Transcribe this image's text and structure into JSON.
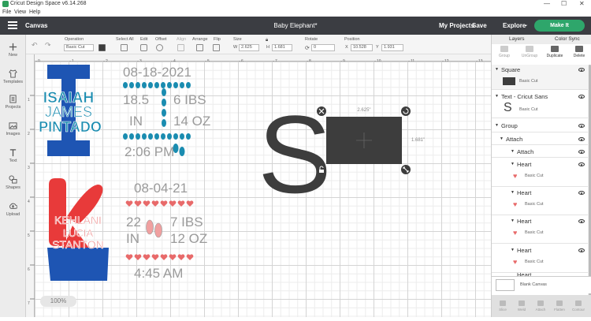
{
  "window": {
    "title": "Cricut Design Space  v6.14.268",
    "minimize": "—",
    "maximize": "☐",
    "close": "✕"
  },
  "menu": [
    "File",
    "View",
    "Help"
  ],
  "topbar": {
    "canvas_label": "Canvas",
    "project_title": "Baby Elephant*",
    "my_projects": "My Projects",
    "save": "Save",
    "explore": "Explore",
    "make_it": "Make It"
  },
  "toolbar": {
    "undo_icon": "undo-icon",
    "redo_icon": "redo-icon",
    "operation_label": "Operation",
    "operation_value": "Basic Cut",
    "select_all_label": "Select All",
    "edit_label": "Edit",
    "offset_label": "Offset",
    "align_label": "Align",
    "arrange_label": "Arrange",
    "flip_label": "Flip",
    "size_label": "Size",
    "w_label": "W",
    "w_value": "2.625",
    "h_label": "H",
    "h_value": "1.681",
    "rotate_label": "Rotate",
    "rotate_value": "0",
    "position_label": "Position",
    "x_label": "X",
    "x_value": "10.528",
    "y_label": "Y",
    "y_value": "1.931",
    "color": "#3d3d3d"
  },
  "left_rail": [
    {
      "label": "New",
      "icon": "plus-icon"
    },
    {
      "label": "Templates",
      "icon": "shirt-icon"
    },
    {
      "label": "Projects",
      "icon": "projects-icon"
    },
    {
      "label": "Images",
      "icon": "image-icon"
    },
    {
      "label": "Text",
      "icon": "text-icon"
    },
    {
      "label": "Shapes",
      "icon": "shapes-icon"
    },
    {
      "label": "Upload",
      "icon": "upload-icon"
    }
  ],
  "ruler": {
    "top": [
      "0",
      "1",
      "2",
      "3",
      "4",
      "5",
      "6",
      "7",
      "8",
      "9",
      "10",
      "11",
      "12",
      "13"
    ],
    "left": [
      "1",
      "2",
      "3",
      "4",
      "5",
      "6",
      "7"
    ]
  },
  "canvas": {
    "isaiah": [
      "ISAIAH",
      "JAMES",
      "PINTADO"
    ],
    "kehlani": [
      "KEHLANI",
      "LUCIA",
      "STANTON"
    ],
    "date1": "08-18-2021",
    "w1": "18.5",
    "lbs1": "6 IBS",
    "in1": "IN",
    "oz1": "14 OZ",
    "time1": "2:06 PM",
    "date2": "08-04-21",
    "w2": "22",
    "lbs2": "7 IBS",
    "in2": "IN",
    "oz2": "12 OZ",
    "time2": "4:45 AM",
    "big_letter": "S",
    "width_label": "2.625\"",
    "height_label": "1.681\"",
    "zoom": "100%",
    "blue": "#1e55b3",
    "teal": "#1a8cb0",
    "red": "#e83a3a",
    "pink": "#e86a6a",
    "gray": "#9a9a9a",
    "dark": "#3d3d3d"
  },
  "layers_panel": {
    "tab_layers": "Layers",
    "tab_color_sync": "Color Sync",
    "tools": [
      "Group",
      "UnGroup",
      "Duplicate",
      "Delete"
    ],
    "square": "Square",
    "square_op": "Basic Cut",
    "text_layer": "Text - Cricut Sans",
    "text_op": "Basic Cut",
    "text_glyph": "S",
    "group": "Group",
    "attach": "Attach",
    "attach2": "Attach",
    "heart": "Heart",
    "heart_op": "Basic Cut",
    "blank_canvas": "Blank Canvas",
    "bottom_tools": [
      "Slice",
      "Weld",
      "Attach",
      "Flatten",
      "Contour"
    ]
  }
}
